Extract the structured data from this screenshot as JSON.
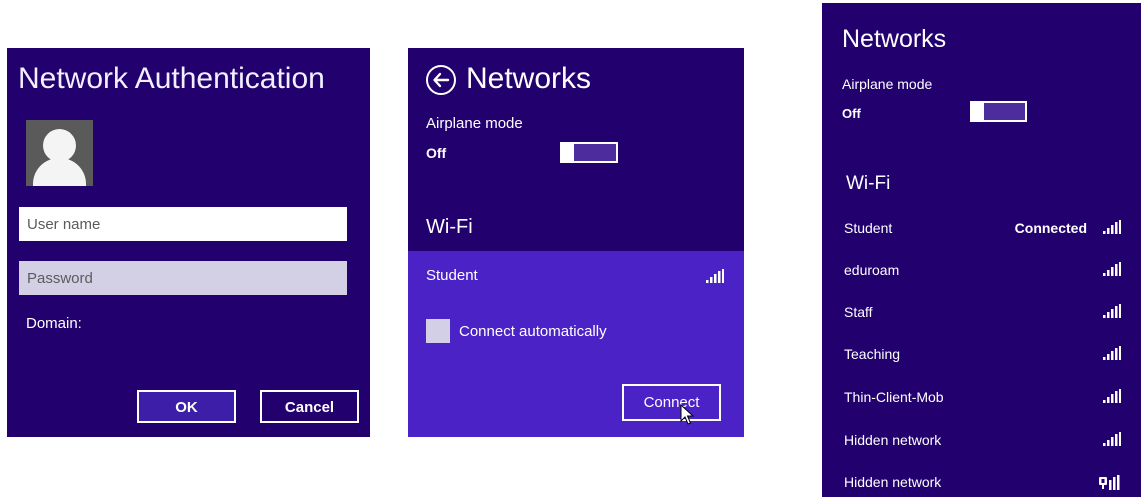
{
  "auth_dialog": {
    "title": "Network Authentication",
    "username_placeholder": "User name",
    "password_placeholder": "Password",
    "domain_label": "Domain:",
    "ok_label": "OK",
    "cancel_label": "Cancel"
  },
  "connect_flyout": {
    "title": "Networks",
    "airplane_mode_label": "Airplane mode",
    "airplane_mode_state": "Off",
    "wifi_heading": "Wi-Fi",
    "selected_network": "Student",
    "connect_auto_label": "Connect automatically",
    "connect_button_label": "Connect"
  },
  "networks_list": {
    "title": "Networks",
    "airplane_mode_label": "Airplane mode",
    "airplane_mode_state": "Off",
    "wifi_heading": "Wi-Fi",
    "networks": [
      {
        "name": "Student",
        "status": "Connected"
      },
      {
        "name": "eduroam",
        "status": ""
      },
      {
        "name": "Staff",
        "status": ""
      },
      {
        "name": "Teaching",
        "status": ""
      },
      {
        "name": "Thin-Client-Mob",
        "status": ""
      },
      {
        "name": "Hidden network",
        "status": ""
      },
      {
        "name": "Hidden network",
        "status": ""
      }
    ]
  },
  "colors": {
    "panel_bg": "#22006e",
    "selected_bg": "#4b22c6",
    "text": "#ffffff"
  },
  "icons": [
    "user-avatar-icon",
    "back-arrow-icon",
    "wifi-signal-icon",
    "wifi-signal-secured-icon",
    "mouse-cursor-icon"
  ]
}
